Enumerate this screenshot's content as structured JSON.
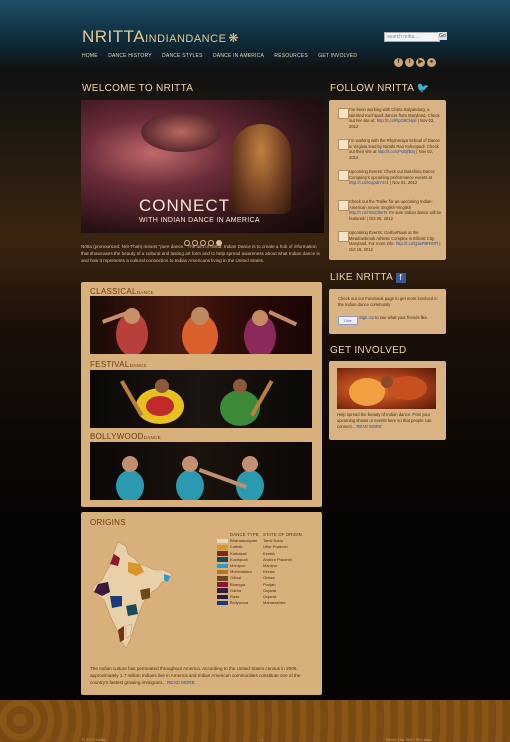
{
  "header": {
    "logo_main": "NRITTA",
    "logo_mid": "INDIAN",
    "logo_end": "DANCE",
    "logo_star": "❋",
    "search_placeholder": "search nritta ...",
    "search_button": "Go",
    "nav": [
      "HOME",
      "DANCE HISTORY",
      "DANCE STYLES",
      "DANCE IN AMERICA",
      "RESOURCES",
      "GET INVOLVED"
    ],
    "social": [
      {
        "icon": "facebook-icon",
        "glyph": "f"
      },
      {
        "icon": "twitter-icon",
        "glyph": "t"
      },
      {
        "icon": "youtube-icon",
        "glyph": "▶"
      },
      {
        "icon": "flickr-icon",
        "glyph": "●"
      }
    ]
  },
  "welcome": {
    "title": "WELCOME TO NRITTA",
    "slide_title": "CONNECT",
    "slide_subtitle": "WITH INDIAN DANCE IN AMERICA",
    "slide_count": 5,
    "active_slide": 5,
    "intro": "Nritta (pronounced: Nrit-Thah) means \"pure dance.\" The aim of Nritta: Indian Dance is to create a hub of information that showcases the beauty of a cultural and lasting art form and to help spread awareness about what Indian dance is and how it represents a cultural connection to Indian Americans living in the United States."
  },
  "categories": [
    {
      "title": "CLASSICAL",
      "suffix": "DANCE"
    },
    {
      "title": "FESTIVAL",
      "suffix": "DANCE"
    },
    {
      "title": "BOLLYWOOD",
      "suffix": "DANCE"
    }
  ],
  "origins": {
    "title": "ORIGINS",
    "col_dance": "DANCE TYPE",
    "col_state": "STATE OF ORIGIN",
    "rows": [
      {
        "dance": "Bharatanatyam",
        "state": "Tamil Nadu",
        "color": "#e8d6b6"
      },
      {
        "dance": "Kathak",
        "state": "Uttar Pradesh",
        "color": "#d9962a"
      },
      {
        "dance": "Kathakali",
        "state": "Kerala",
        "color": "#7a2e10"
      },
      {
        "dance": "Kuchipudi",
        "state": "Andhra Pradesh",
        "color": "#1a4a5a"
      },
      {
        "dance": "Manipuri",
        "state": "Manipur",
        "color": "#2a9ad0"
      },
      {
        "dance": "Mohiniattam",
        "state": "Kerala",
        "color": "#b8742a"
      },
      {
        "dance": "Odissi",
        "state": "Orissa",
        "color": "#6a4a1a"
      },
      {
        "dance": "Bhangra",
        "state": "Punjab",
        "color": "#8a1a2a"
      },
      {
        "dance": "Garba",
        "state": "Gujarat",
        "color": "#3a1a3a"
      },
      {
        "dance": "Raas",
        "state": "Gujarat",
        "color": "#2a1a4a"
      },
      {
        "dance": "Bollywood",
        "state": "Maharashtra",
        "color": "#1a3a7a"
      }
    ],
    "text": "The Indian culture has permeated throughout America. According to the United States census in 2000, approximately 1.7 million Indians live in America and Indian American communities constitute one of the country's fastest growing immigrant...",
    "read_more": "READ MORE"
  },
  "sidebar": {
    "follow_title": "FOLLOW NRITTA",
    "tweets": [
      {
        "text": "I've been working with Chitra Kalyandurg, a talented Kuchipudi dancer from Maryland. Check out her site at:",
        "link": "http://t.co/RpO8Cl4jsI",
        "date": "Nov 03, 2012"
      },
      {
        "text": "I'm working with the Rhythmaya School of Dance in Virginia lead by Nirathi Rao Kolivepudi. Check out their site at",
        "link": "http://t.co/cPct0jfBSj",
        "date": "Nov 02, 2012"
      },
      {
        "text": "Upcoming Events: Check out Dakshina Dance Company's upcoming performance events at",
        "link": "http://t.co/KupsbY4z1",
        "date": "Nov 01, 2012"
      },
      {
        "text": "Check out the Trailer for an upcoming Indian-American movie: English-Vinglish",
        "link": "http://t.co/rrMiCl9nTs",
        "date": "Oct 25, 2012",
        "extra": "I'm sure Indian dance will be featured!"
      },
      {
        "text": "Upcoming Events: GarbarRaas at the Meadowbrook Athletic Complex in Ellicott City, Maryland. For more info:",
        "link": "http://t.co/QacFBRs0Tl",
        "date": "Oct 19, 2012"
      }
    ],
    "like_title": "LIKE NRITTA",
    "fb_text": "Check out our Facebook page to get more involved in the Indian dance community",
    "fb_like": "Like",
    "fb_signup": "Sign Up",
    "fb_signup_rest": "to see what your friends like.",
    "gi_title": "GET INVOLVED",
    "gi_text": "Help spread the beauty of Indian dance. Post your upcoming shows or events here so that people can connect...",
    "gi_read_more": "READ MORE"
  },
  "footer": {
    "left": "© 2012 Nritta",
    "center": "1",
    "right": "About The Site | Site Map"
  }
}
